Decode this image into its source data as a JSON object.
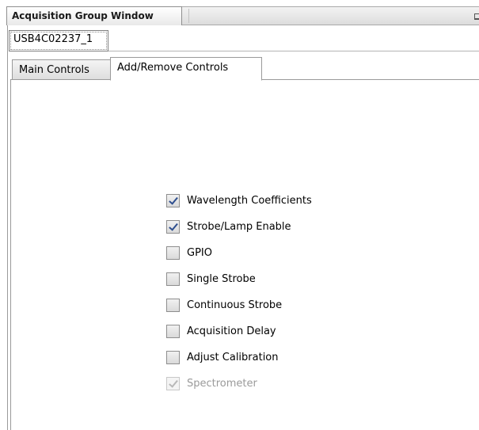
{
  "window": {
    "title": "Acquisition Group Window"
  },
  "device_tab": {
    "label": "USB4C02237_1"
  },
  "tabs": [
    {
      "label": "Main Controls",
      "active": false
    },
    {
      "label": "Add/Remove Controls",
      "active": true
    }
  ],
  "controls": [
    {
      "label": "Wavelength Coefficients",
      "checked": true,
      "enabled": true
    },
    {
      "label": "Strobe/Lamp Enable",
      "checked": true,
      "enabled": true
    },
    {
      "label": "GPIO",
      "checked": false,
      "enabled": true
    },
    {
      "label": "Single Strobe",
      "checked": false,
      "enabled": true
    },
    {
      "label": "Continuous Strobe",
      "checked": false,
      "enabled": true
    },
    {
      "label": "Acquisition Delay",
      "checked": false,
      "enabled": true
    },
    {
      "label": "Adjust Calibration",
      "checked": false,
      "enabled": true
    },
    {
      "label": "Spectrometer",
      "checked": true,
      "enabled": false
    }
  ],
  "icons": {
    "minimize": "minimize-icon",
    "checkmark": "checkmark-icon"
  }
}
